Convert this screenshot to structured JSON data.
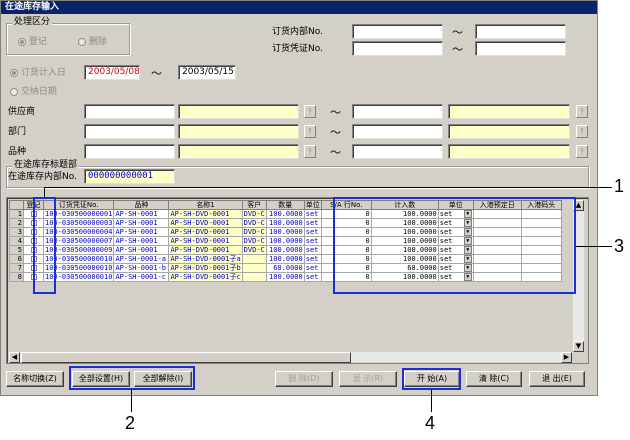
{
  "window": {
    "title": "在途库存输入"
  },
  "register_group": {
    "label": "处理区分",
    "option_register": "登记",
    "option_delete": "删除"
  },
  "order_internal": {
    "label": "订货内部No.",
    "from": "",
    "to": ""
  },
  "order_voucher": {
    "label": "订货凭证No.",
    "from": "",
    "to": ""
  },
  "date_mode": {
    "option_order_date": "订货计入日",
    "option_delivery_date": "交纳日期",
    "from": "2003/05/08",
    "to": "2003/05/15"
  },
  "filters": [
    {
      "label": "供应商"
    },
    {
      "label": "部门"
    },
    {
      "label": "品种"
    }
  ],
  "separator": "～",
  "lookup_glyph": "!",
  "header_group": {
    "label": "在途库存标题部",
    "field_label": "在途库存内部No.",
    "field_value": "000000000001"
  },
  "grid": {
    "columns": [
      "登记",
      "订货凭证No.",
      "品种",
      "名称1",
      "客户",
      "数量",
      "单位",
      "S/A 行No.",
      "计入数",
      "单位",
      "入港预定日",
      "入港码头"
    ],
    "rows": [
      {
        "no": "1",
        "voucher": "100-030500000001",
        "item": "AP-SH-0001",
        "name": "AP-SH-DVD-0001",
        "customer": "DVD-C",
        "qty": "100.0000",
        "unit": "set",
        "sa": "0",
        "count": "100.0000",
        "unit2": "set"
      },
      {
        "no": "2",
        "voucher": "100-030500000003",
        "item": "AP-SH-0001",
        "name": "AP-SH-DVD-0001",
        "customer": "DVD-C",
        "qty": "100.0000",
        "unit": "set",
        "sa": "0",
        "count": "100.0000",
        "unit2": "set"
      },
      {
        "no": "3",
        "voucher": "100-030500000004",
        "item": "AP-SH-0001",
        "name": "AP-SH-DVD-0001",
        "customer": "DVD-C",
        "qty": "100.0000",
        "unit": "set",
        "sa": "0",
        "count": "100.0000",
        "unit2": "set"
      },
      {
        "no": "4",
        "voucher": "100-030500000007",
        "item": "AP-SH-0001",
        "name": "AP-SH-DVD-0001",
        "customer": "DVD-C",
        "qty": "100.0000",
        "unit": "set",
        "sa": "0",
        "count": "100.0000",
        "unit2": "set"
      },
      {
        "no": "5",
        "voucher": "100-030500000009",
        "item": "AP-SH-0001",
        "name": "AP-SH-DVD-0001",
        "customer": "DVD-C",
        "qty": "100.0000",
        "unit": "set",
        "sa": "0",
        "count": "100.0000",
        "unit2": "set"
      },
      {
        "no": "6",
        "voucher": "100-030500000010",
        "item": "AP-SH-0001-a",
        "name": "AP-SH-DVD-0001子a",
        "customer": "",
        "qty": "100.0000",
        "unit": "set",
        "sa": "0",
        "count": "100.0000",
        "unit2": "set"
      },
      {
        "no": "7",
        "voucher": "100-030500000010",
        "item": "AP-SH-0001-b",
        "name": "AP-SH-DVD-0001子b",
        "customer": "",
        "qty": "60.0000",
        "unit": "set",
        "sa": "0",
        "count": "60.0000",
        "unit2": "set"
      },
      {
        "no": "8",
        "voucher": "100-030500000010",
        "item": "AP-SH-0001-c",
        "name": "AP-SH-DVD-0001子c",
        "customer": "",
        "qty": "100.0000",
        "unit": "set",
        "sa": "0",
        "count": "100.0000",
        "unit2": "set"
      }
    ]
  },
  "buttons": {
    "name_switch": "名称切换(Z)",
    "select_all": "全部设置(H)",
    "clear_all": "全部解除(I)",
    "delete": "删 除(D)",
    "display": "显 示(R)",
    "start": "开 始(A)",
    "clear": "清 除(C)",
    "exit": "退 出(E)"
  },
  "callouts": [
    "1",
    "2",
    "3",
    "4"
  ],
  "colors": {
    "title_bar": "#0a246a",
    "highlight": "#1a2fd6",
    "date_red": "#d40000",
    "grid_blue_text": "#0000cc",
    "yellow_field": "#ffffc8"
  }
}
